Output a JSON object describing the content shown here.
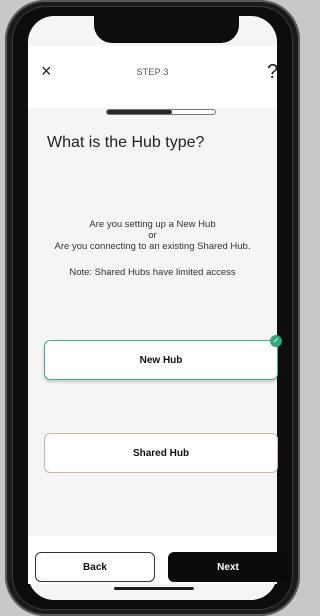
{
  "header": {
    "step_title": "STEP 3",
    "close_icon": "×",
    "help_icon": "?"
  },
  "progress": {
    "fraction": 0.6
  },
  "question": "What is the Hub type?",
  "info": {
    "line1": "Are you setting up a New Hub",
    "line2": "or",
    "line3": "Are you connecting to an existing Shared Hub.",
    "note": "Note: Shared Hubs have limited access"
  },
  "options": [
    {
      "label": "New Hub",
      "selected": true
    },
    {
      "label": "Shared Hub",
      "selected": false
    }
  ],
  "check_icon": "✓",
  "footer": {
    "back_label": "Back",
    "next_label": "Next"
  },
  "colors": {
    "accent": "#3fb492",
    "check": "#2ea879",
    "unselected_border": "#c9b8a3",
    "next_bg": "#0a0a0a"
  }
}
